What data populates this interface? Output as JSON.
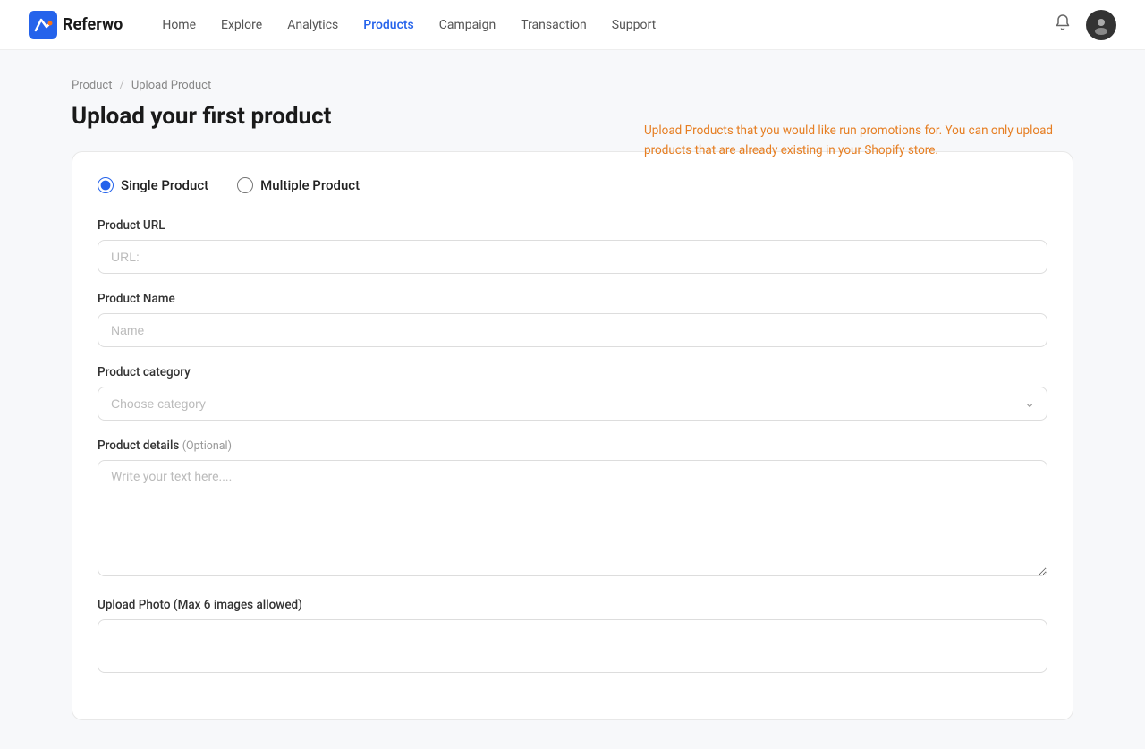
{
  "app": {
    "name": "Referwo"
  },
  "navbar": {
    "links": [
      {
        "id": "home",
        "label": "Home",
        "active": false
      },
      {
        "id": "explore",
        "label": "Explore",
        "active": false
      },
      {
        "id": "analytics",
        "label": "Analytics",
        "active": false
      },
      {
        "id": "products",
        "label": "Products",
        "active": true
      },
      {
        "id": "campaign",
        "label": "Campaign",
        "active": false
      },
      {
        "id": "transaction",
        "label": "Transaction",
        "active": false
      },
      {
        "id": "support",
        "label": "Support",
        "active": false
      }
    ]
  },
  "breadcrumb": {
    "parent": "Product",
    "separator": "/",
    "current": "Upload Product"
  },
  "page": {
    "title": "Upload your first product"
  },
  "info": {
    "text": "Upload Products that you would like run promotions for. You can only upload products that are already existing in your Shopify store."
  },
  "form": {
    "radio": {
      "option1_label": "Single Product",
      "option2_label": "Multiple Product"
    },
    "url_label": "Product URL",
    "url_placeholder": "URL:",
    "name_label": "Product Name",
    "name_placeholder": "Name",
    "category_label": "Product category",
    "category_placeholder": "Choose category",
    "details_label": "Product details",
    "details_optional": "(Optional)",
    "details_placeholder": "Write your text here....",
    "photo_label": "Upload Photo (Max 6 images allowed)"
  }
}
